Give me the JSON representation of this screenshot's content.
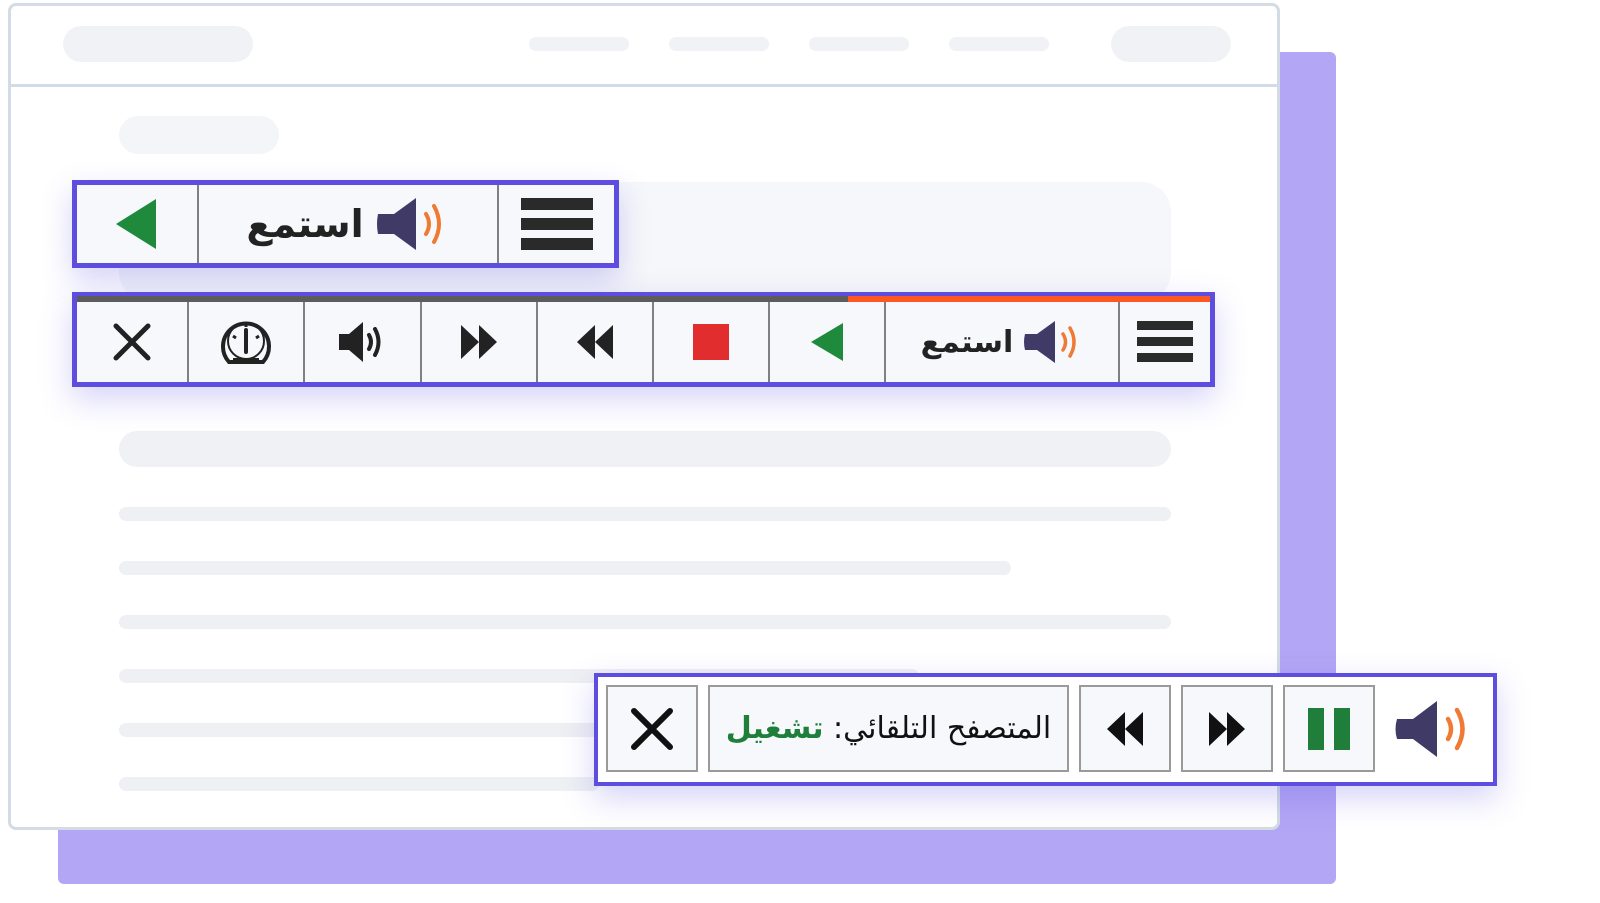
{
  "player_compact": {
    "listen_label": "استمع"
  },
  "player_expanded": {
    "listen_label": "استمع"
  },
  "auto_browse": {
    "label": "المتصفح التلقائي:",
    "value": "تشغيل"
  },
  "icons": {
    "menu": "hamburger-menu-icon",
    "speaker": "speaker-icon",
    "play": "play-icon",
    "stop": "stop-icon",
    "rewind": "rewind-icon",
    "fast_forward": "fast-forward-icon",
    "volume": "volume-icon",
    "speed": "speedometer-icon",
    "close": "close-icon",
    "pause": "pause-icon"
  },
  "colors": {
    "accent": "#5d4ee0",
    "play_green": "#1f8a3c",
    "stop_red": "#e12d2d",
    "speaker_body": "#3f3b66",
    "speaker_waves": "#f07a33",
    "progress": "#ff5722"
  }
}
